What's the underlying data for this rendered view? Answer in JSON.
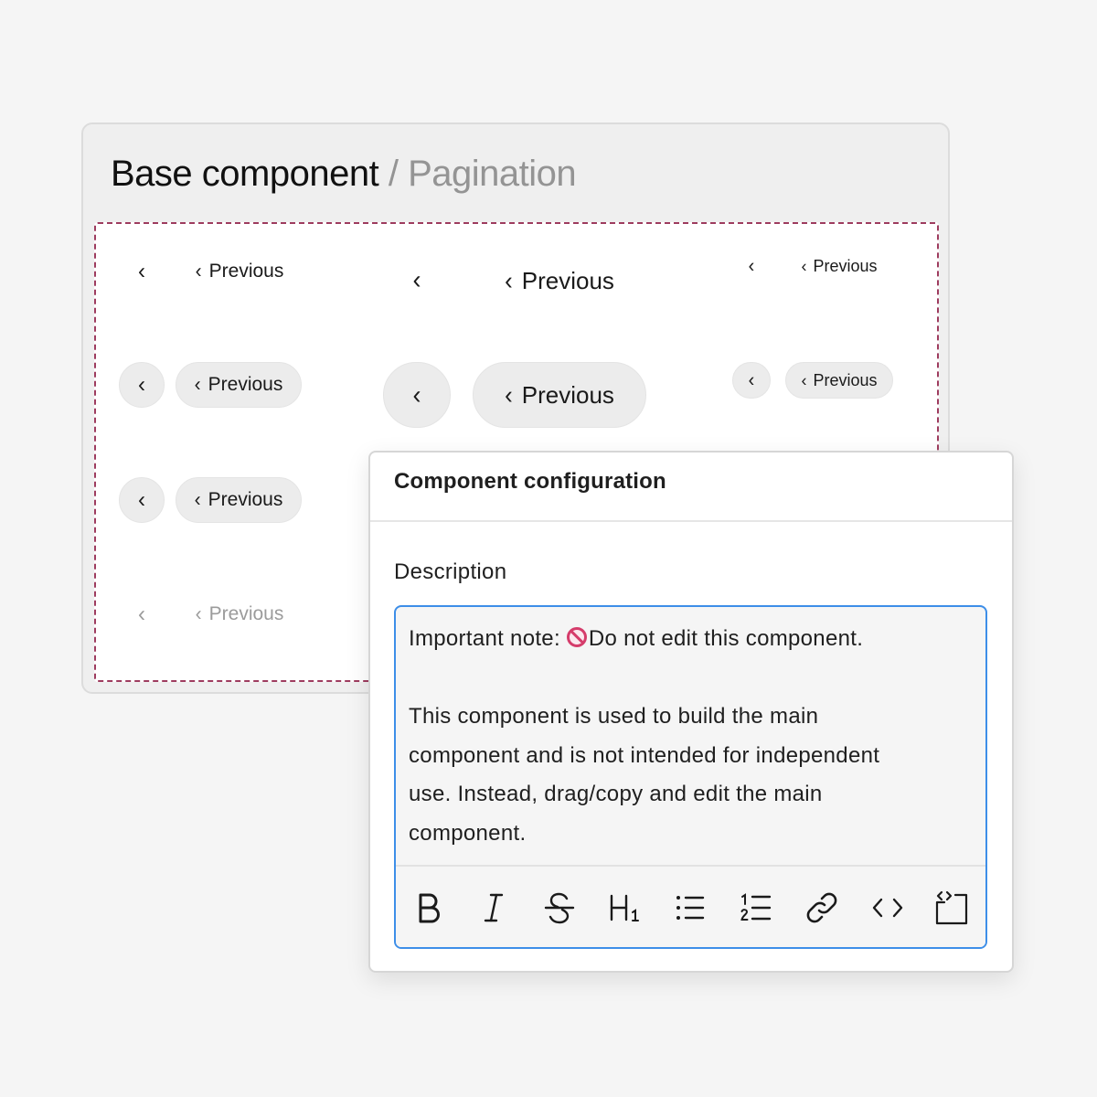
{
  "header": {
    "title_main": "Base component",
    "title_separator": "/",
    "title_sub": "Pagination"
  },
  "pagination_variants": {
    "chevron": "‹",
    "label": "Previous"
  },
  "config_panel": {
    "title": "Component configuration",
    "description_label": "Description",
    "editor": {
      "line1_prefix": "Important note: ",
      "line1_suffix": "Do not edit this component.",
      "paragraph": [
        "This component is used to build the main",
        "component and is not intended for independent",
        "use. Instead, drag/copy and edit the main",
        "component."
      ]
    },
    "toolbar": [
      "bold-icon",
      "italic-icon",
      "strikethrough-icon",
      "heading-1-icon",
      "bulleted-list-icon",
      "numbered-list-icon",
      "link-icon",
      "code-icon",
      "code-block-icon"
    ]
  },
  "colors": {
    "dashed_border": "#9e3c5f",
    "editor_focus": "#3d8ee8",
    "pill_bg": "#ececec"
  }
}
